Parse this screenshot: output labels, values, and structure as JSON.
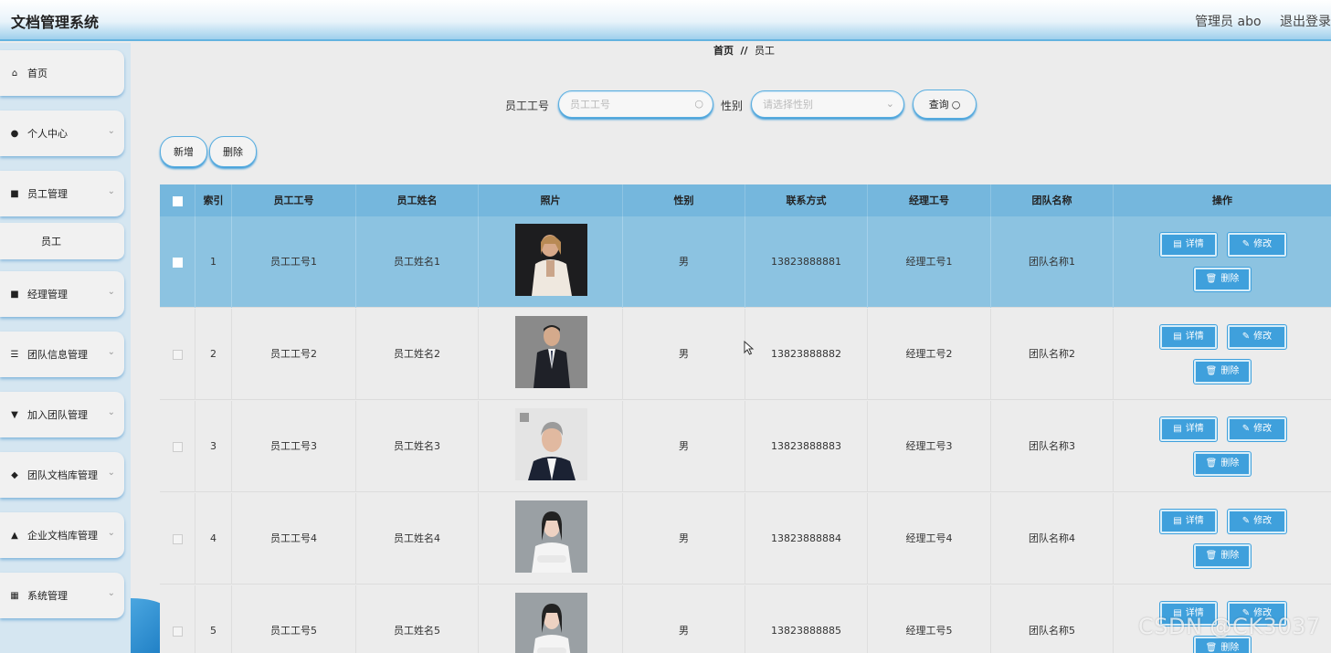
{
  "app": {
    "title": "文档管理系统",
    "user": "管理员 abo",
    "logout": "退出登录"
  },
  "sidebar": {
    "items": [
      {
        "label": "首页",
        "icon": "home-icon",
        "glyph": "⌂",
        "expandable": false
      },
      {
        "label": "个人中心",
        "icon": "user-icon",
        "glyph": "●",
        "expandable": true
      },
      {
        "label": "员工管理",
        "icon": "grid-icon",
        "glyph": "■",
        "expandable": true
      },
      {
        "label": "经理管理",
        "icon": "grid-icon",
        "glyph": "■",
        "expandable": true
      },
      {
        "label": "团队信息管理",
        "icon": "sliders-icon",
        "glyph": "☰",
        "expandable": true
      },
      {
        "label": "加入团队管理",
        "icon": "flag-icon",
        "glyph": "▼",
        "expandable": true
      },
      {
        "label": "团队文档库管理",
        "icon": "ticket-icon",
        "glyph": "◆",
        "expandable": true
      },
      {
        "label": "企业文档库管理",
        "icon": "person-icon",
        "glyph": "▲",
        "expandable": true
      },
      {
        "label": "系统管理",
        "icon": "apps-icon",
        "glyph": "▦",
        "expandable": true
      }
    ],
    "subitem": "员工"
  },
  "breadcrumb": {
    "home": "首页",
    "separator": "//",
    "current": "员工"
  },
  "search": {
    "employee_id_label": "员工工号",
    "employee_id_placeholder": "员工工号",
    "gender_label": "性别",
    "gender_placeholder": "请选择性别",
    "query_button": "查询"
  },
  "actions": {
    "add": "新增",
    "delete": "删除"
  },
  "table": {
    "columns": [
      "索引",
      "员工工号",
      "员工姓名",
      "照片",
      "性别",
      "联系方式",
      "经理工号",
      "团队名称",
      "操作"
    ],
    "rows": [
      {
        "index": "1",
        "emp_id": "员工工号1",
        "name": "员工姓名1",
        "gender": "男",
        "phone": "13823888881",
        "mgr_id": "经理工号1",
        "team": "团队名称1",
        "selected": true
      },
      {
        "index": "2",
        "emp_id": "员工工号2",
        "name": "员工姓名2",
        "gender": "男",
        "phone": "13823888882",
        "mgr_id": "经理工号2",
        "team": "团队名称2",
        "selected": false
      },
      {
        "index": "3",
        "emp_id": "员工工号3",
        "name": "员工姓名3",
        "gender": "男",
        "phone": "13823888883",
        "mgr_id": "经理工号3",
        "team": "团队名称3",
        "selected": false
      },
      {
        "index": "4",
        "emp_id": "员工工号4",
        "name": "员工姓名4",
        "gender": "男",
        "phone": "13823888884",
        "mgr_id": "经理工号4",
        "team": "团队名称4",
        "selected": false
      },
      {
        "index": "5",
        "emp_id": "员工工号5",
        "name": "员工姓名5",
        "gender": "男",
        "phone": "13823888885",
        "mgr_id": "经理工号5",
        "team": "团队名称5",
        "selected": false
      }
    ],
    "row_actions": {
      "detail": "详情",
      "edit": "修改",
      "delete": "删除"
    }
  },
  "watermark": "CSDN @CK3037",
  "colors": {
    "accent": "#3fa0dc",
    "header": "#75b7dd",
    "selected_row": "#8cc3e1"
  }
}
